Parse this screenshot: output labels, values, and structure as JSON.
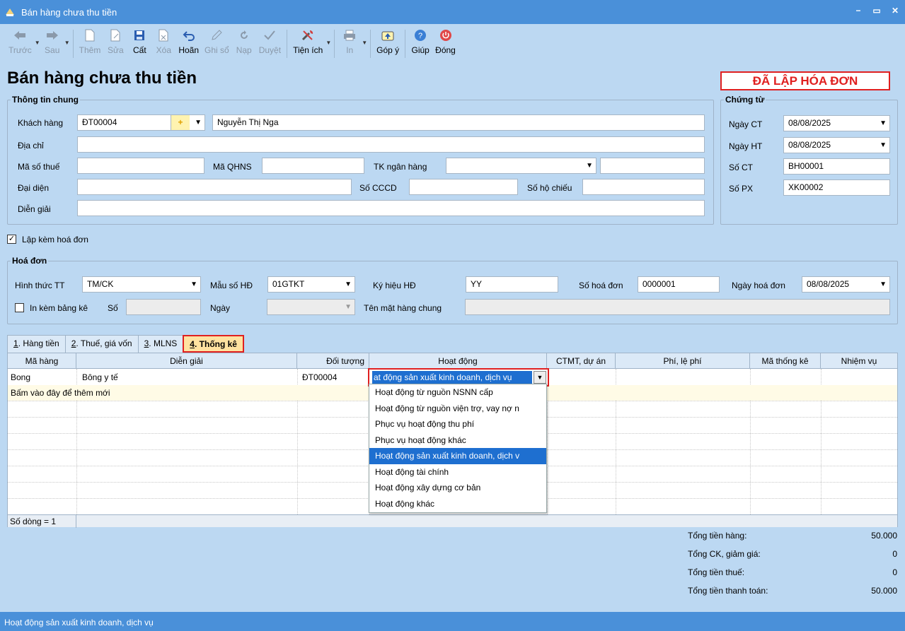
{
  "window": {
    "title": "Bán hàng chưa thu tiền"
  },
  "toolbar": {
    "prev": "Trước",
    "next": "Sau",
    "add": "Thêm",
    "edit": "Sửa",
    "save": "Cất",
    "delete": "Xóa",
    "undo": "Hoãn",
    "post": "Ghi sổ",
    "load": "Nạp",
    "approve": "Duyệt",
    "utilities": "Tiện ích",
    "print": "In",
    "feedback": "Góp ý",
    "help": "Giúp",
    "close": "Đóng"
  },
  "page": {
    "heading": "Bán hàng chưa thu tiền",
    "status": "ĐÃ LẬP HÓA ĐƠN"
  },
  "general_info": {
    "legend": "Thông tin chung",
    "customer_label": "Khách hàng",
    "customer_code": "ĐT00004",
    "customer_name": "Nguyễn Thị Nga",
    "address_label": "Địa chỉ",
    "tax_code_label": "Mã số thuế",
    "qhns_label": "Mã QHNS",
    "bank_account_label": "TK ngân hàng",
    "representative_label": "Đại diện",
    "id_card_label": "Số CCCD",
    "passport_label": "Số hộ chiếu",
    "description_label": "Diễn giải"
  },
  "voucher": {
    "legend": "Chứng từ",
    "date_ct_label": "Ngày CT",
    "date_ct": "08/08/2025",
    "date_ht_label": "Ngày HT",
    "date_ht": "08/08/2025",
    "number_ct_label": "Số CT",
    "number_ct": "BH00001",
    "number_px_label": "Số PX",
    "number_px": "XK00002"
  },
  "attach_invoice": {
    "label": "Lập kèm hoá đơn",
    "checked": true
  },
  "invoice": {
    "legend": "Hoá đơn",
    "payment_label": "Hình thức TT",
    "payment": "TM/CK",
    "template_label": "Mẫu số HĐ",
    "template": "01GTKT",
    "symbol_label": "Ký hiệu HĐ",
    "symbol": "YY",
    "number_label": "Số hoá đơn",
    "number": "0000001",
    "date_label": "Ngày hoá đơn",
    "date": "08/08/2025",
    "print_list_label": "In kèm bảng kê",
    "so_label": "Số",
    "ngay_label": "Ngày",
    "common_item_label": "Tên mặt hàng chung"
  },
  "tabs": [
    {
      "key": "1",
      "rest": ". Hàng tiền"
    },
    {
      "key": "2",
      "rest": ". Thuế, giá vốn"
    },
    {
      "key": "3",
      "rest": ". MLNS"
    },
    {
      "key": "4",
      "rest": ". Thống kê"
    }
  ],
  "grid": {
    "columns": [
      "Mã hàng",
      "Diễn giải",
      "Đối tượng",
      "Hoạt động",
      "CTMT, dự án",
      "Phí, lệ phí",
      "Mã thống kê",
      "Nhiệm vụ"
    ],
    "row": {
      "code": "Bong",
      "description": "Bông y tế",
      "object": "ĐT00004",
      "activity": "at động sản xuất kinh doanh, dịch vụ"
    },
    "add_row_hint": "Bấm vào đây để thêm mới",
    "row_count": "Số dòng = 1"
  },
  "activity_options": [
    "Hoạt động từ nguồn NSNN cấp",
    "Hoạt động từ nguồn viện trợ, vay nợ n",
    "Phục vụ hoạt động thu phí",
    "Phục vụ hoạt động khác",
    "Hoạt động sản xuất kinh doanh, dịch v",
    "Hoạt động tài chính",
    "Hoạt động xây dựng cơ bản",
    "Hoạt động khác"
  ],
  "activity_selected_index": 4,
  "totals": {
    "goods_label": "Tổng tiền hàng:",
    "goods": "50.000",
    "discount_label": "Tổng CK, giảm giá:",
    "discount": "0",
    "tax_label": "Tổng tiền thuế:",
    "tax": "0",
    "payment_label": "Tổng tiền thanh toán:",
    "payment": "50.000"
  },
  "statusbar": {
    "text": "Hoạt động sản xuất kinh doanh, dịch vụ"
  },
  "colors": {
    "titlebar": "#4a90d9",
    "background": "#bcd8f2",
    "status_red": "#e02020",
    "selection": "#1e6fd0"
  }
}
